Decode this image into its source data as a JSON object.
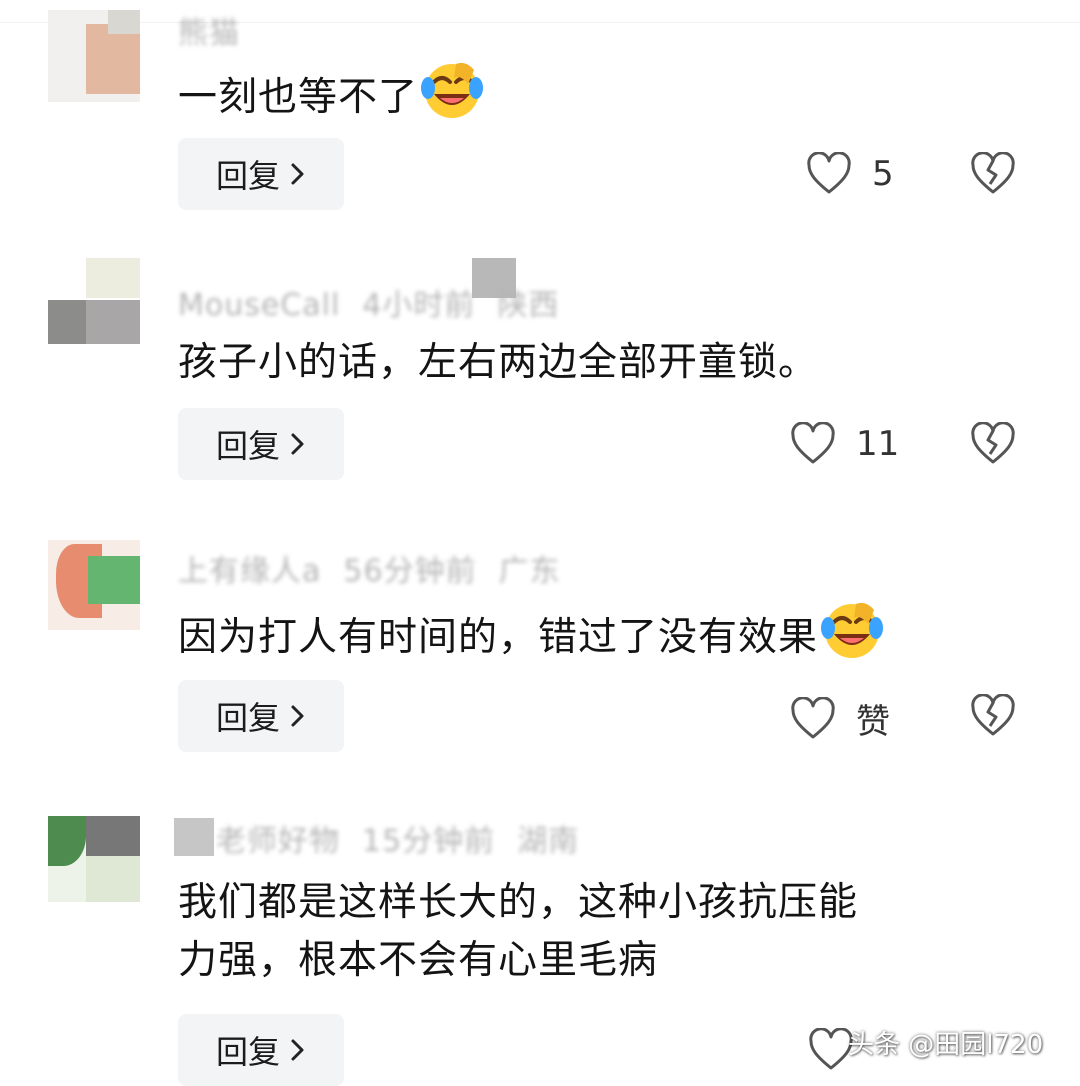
{
  "comments": [
    {
      "meta_name": "熊猫",
      "meta_time": "",
      "meta_loc": "",
      "text": "一刻也等不了",
      "emoji": "laughing-tears-emoji",
      "reply_label": "回复",
      "like_count": "5"
    },
    {
      "meta_name": "MouseCall",
      "meta_time": "4小时前",
      "meta_loc": "陕西",
      "text": "孩子小的话，左右两边全部开童锁。",
      "emoji": "",
      "reply_label": "回复",
      "like_count": "11"
    },
    {
      "meta_name": "上有缘人a",
      "meta_time": "56分钟前",
      "meta_loc": "广东",
      "text": "因为打人有时间的，错过了没有效果",
      "emoji": "laughing-tears-emoji",
      "reply_label": "回复",
      "like_count": "赞"
    },
    {
      "meta_name": "老师好物",
      "meta_time": "15分钟前",
      "meta_loc": "湖南",
      "text_line1": "我们都是这样长大的，这种小孩抗压能",
      "text_line2": "力强，根本不会有心里毛病",
      "emoji": "",
      "reply_label": "回复",
      "like_count": ""
    }
  ],
  "watermark": "头条 @田园l720",
  "colors": {
    "reply_bg": "#f3f4f6",
    "meta_gray": "#b5b5b5",
    "text": "#141414",
    "icon_gray": "#555555"
  }
}
